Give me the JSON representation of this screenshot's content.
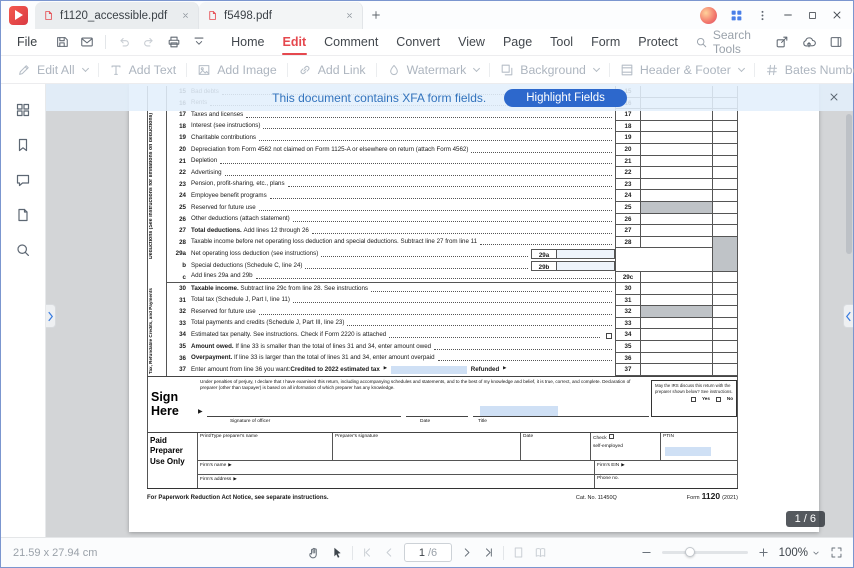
{
  "titlebar": {
    "tabs": [
      {
        "label": "f1120_accessible.pdf",
        "active": true
      },
      {
        "label": "f5498.pdf",
        "active": false
      }
    ],
    "right_icons": [
      {
        "name": "avatar"
      },
      {
        "name": "apps-grid-icon"
      },
      {
        "name": "more-menu-icon"
      },
      {
        "name": "minimize-button"
      },
      {
        "name": "maximize-button"
      },
      {
        "name": "close-button"
      }
    ]
  },
  "menubar": {
    "file_label": "File",
    "left_icons": [
      {
        "name": "save-icon"
      },
      {
        "name": "mail-icon"
      },
      {
        "name": "divider"
      },
      {
        "name": "undo-icon",
        "disabled": true
      },
      {
        "name": "redo-icon",
        "disabled": true
      },
      {
        "name": "print-icon"
      },
      {
        "name": "collapse-toolbar-icon"
      }
    ],
    "items": [
      {
        "label": "Home"
      },
      {
        "label": "Edit",
        "active": true
      },
      {
        "label": "Comment"
      },
      {
        "label": "Convert"
      },
      {
        "label": "View"
      },
      {
        "label": "Page"
      },
      {
        "label": "Tool"
      },
      {
        "label": "Form"
      },
      {
        "label": "Protect"
      }
    ],
    "search_label": "Search Tools",
    "right_icons": [
      {
        "name": "share-icon"
      },
      {
        "name": "cloud-upload-icon"
      },
      {
        "name": "reading-panel-icon"
      }
    ]
  },
  "toolbar": {
    "items": [
      {
        "label": "Edit All",
        "icon": "edit-all-icon",
        "dropdown": true
      },
      {
        "label": "Add Text",
        "icon": "add-text-icon",
        "dropdown": false
      },
      {
        "label": "Add Image",
        "icon": "add-image-icon",
        "dropdown": false
      },
      {
        "label": "Add Link",
        "icon": "add-link-icon",
        "dropdown": false
      },
      {
        "label": "Watermark",
        "icon": "watermark-icon",
        "dropdown": true
      },
      {
        "label": "Background",
        "icon": "background-icon",
        "dropdown": true
      },
      {
        "label": "Header & Footer",
        "icon": "header-footer-icon",
        "dropdown": true
      },
      {
        "label": "Bates Number",
        "icon": "bates-number-icon",
        "dropdown": true
      }
    ]
  },
  "sidebar": {
    "icons": [
      {
        "name": "thumbnails-icon"
      },
      {
        "name": "bookmarks-icon"
      },
      {
        "name": "comments-icon"
      },
      {
        "name": "page-icon"
      },
      {
        "name": "search-pages-icon"
      }
    ]
  },
  "notification": {
    "message": "This document contains XFA form fields.",
    "button_label": "Highlight Fields"
  },
  "form": {
    "section_labels": {
      "deductions": "Deductions (See instructions for limitations on deductions)",
      "tax": "Tax, Refundable Credits, and Payments"
    },
    "lines": [
      {
        "num": "15",
        "label": "Bad debts",
        "right": "15"
      },
      {
        "num": "16",
        "label": "Rents",
        "right": "16"
      },
      {
        "num": "17",
        "label": "Taxes and licenses",
        "right": "17"
      },
      {
        "num": "18",
        "label": "Interest (see instructions)",
        "right": "18"
      },
      {
        "num": "19",
        "label": "Charitable contributions",
        "right": "19"
      },
      {
        "num": "20",
        "label": "Depreciation from Form 4562 not claimed on Form 1125-A or elsewhere on return (attach Form 4562)",
        "right": "20"
      },
      {
        "num": "21",
        "label": "Depletion",
        "right": "21"
      },
      {
        "num": "22",
        "label": "Advertising",
        "right": "22"
      },
      {
        "num": "23",
        "label": "Pension, profit-sharing, etc., plans",
        "right": "23"
      },
      {
        "num": "24",
        "label": "Employee benefit programs",
        "right": "24"
      },
      {
        "num": "25",
        "label": "Reserved for future use",
        "right": "25",
        "shaded": true
      },
      {
        "num": "26",
        "label": "Other deductions (attach statement)",
        "right": "26"
      },
      {
        "num": "27",
        "bold": "Total deductions.",
        "label": "Add lines 12 through 26",
        "right": "27"
      },
      {
        "num": "28",
        "label": "Taxable income before net operating loss deduction and special deductions. Subtract line 27 from line 11",
        "right": "28",
        "tailShaded": true,
        "tailOpen": true
      },
      {
        "num": "29a",
        "label": "Net operating loss deduction (see instructions)",
        "inline": "29a",
        "rblank": true,
        "amtOpen": true,
        "tailShaded": true,
        "tailOpen": true
      },
      {
        "num": "b",
        "label": "Special deductions (Schedule C, line 24)",
        "inline": "29b",
        "rblank": true,
        "rclose": true,
        "tailShaded": true
      },
      {
        "num": "c",
        "label": "Add lines 29a and 29b",
        "right": "29c",
        "thick": true
      },
      {
        "num": "30",
        "bold": "Taxable income.",
        "label": "Subtract line 29c from line 28. See instructions",
        "right": "30"
      },
      {
        "num": "31",
        "label": "Total tax (Schedule J, Part I, line 11)",
        "right": "31"
      },
      {
        "num": "32",
        "label": "Reserved for future use",
        "right": "32",
        "shaded": true
      },
      {
        "num": "33",
        "label": "Total payments and credits (Schedule J, Part III, line 23)",
        "right": "33"
      },
      {
        "num": "34",
        "label": "Estimated tax penalty. See instructions. Check if Form 2220 is attached",
        "right": "34",
        "checkbox": true
      },
      {
        "num": "35",
        "bold": "Amount owed.",
        "label": "If line 33 is smaller than the total of lines 31 and 34, enter amount owed",
        "right": "35"
      },
      {
        "num": "36",
        "bold": "Overpayment.",
        "label": "If line 33 is larger than the total of lines 31 and 34, enter amount overpaid",
        "right": "36"
      },
      {
        "num": "37",
        "pre": "Enter amount from line 36 you want: ",
        "bold": "Credited to 2022 estimated tax",
        "label": "",
        "label2": "Refunded",
        "right": "37",
        "field": true
      }
    ],
    "sign": {
      "perjury": "Under penalties of perjury, I declare that I have examined this return, including accompanying schedules and statements, and to the best of my knowledge and belief, it is true, correct, and complete. Declaration of preparer (other than taxpayer) is based on all information of which preparer has any knowledge.",
      "title_line1": "Sign",
      "title_line2": "Here",
      "signature_label": "Signature of officer",
      "date_label": "Date",
      "title_label": "Title",
      "irs_question": "May the IRS discuss this return with the preparer shown below? See instructions.",
      "yes_label": "Yes",
      "no_label": "No"
    },
    "preparer": {
      "title_line1": "Paid",
      "title_line2": "Preparer",
      "title_line3": "Use Only",
      "print_name_label": "Print/Type preparer's name",
      "signature_label": "Preparer's signature",
      "date_label": "Date",
      "check_label": "Check",
      "self_employed_label": "self-employed",
      "ptin_label": "PTIN",
      "firm_name_label": "Firm's name",
      "firm_ein_label": "Firm's EIN",
      "firm_address_label": "Firm's address",
      "phone_label": "Phone no."
    },
    "footer": {
      "notice": "For Paperwork Reduction Act Notice, see separate instructions.",
      "cat": "Cat. No. 11450Q",
      "form": "Form",
      "form_number": "1120",
      "form_year": "(2021)"
    }
  },
  "page_badge": "1 / 6",
  "statusbar": {
    "dimensions_label": "21.59 x 27.94 cm",
    "tool_icons": [
      {
        "name": "hand-icon"
      },
      {
        "name": "select-cursor-icon",
        "active": true
      }
    ],
    "nav_icons_left": [
      {
        "name": "first-page-icon",
        "disabled": true
      },
      {
        "name": "prev-page-icon",
        "disabled": true
      }
    ],
    "page_value": "1",
    "page_total": "/6",
    "nav_icons_right": [
      {
        "name": "next-page-icon"
      },
      {
        "name": "last-page-icon"
      }
    ],
    "view_icons": [
      {
        "name": "single-page-icon",
        "disabled": true
      },
      {
        "name": "book-view-icon",
        "disabled": true
      }
    ],
    "zoom_value": "100%",
    "zoom_slider_percent": 33
  }
}
